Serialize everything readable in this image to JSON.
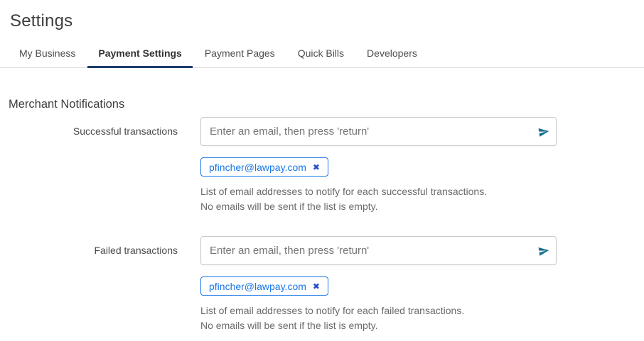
{
  "page_title": "Settings",
  "tabs": [
    {
      "label": "My Business"
    },
    {
      "label": "Payment Settings"
    },
    {
      "label": "Payment Pages"
    },
    {
      "label": "Quick Bills"
    },
    {
      "label": "Developers"
    }
  ],
  "active_tab": "Payment Settings",
  "section_title": "Merchant Notifications",
  "groups": [
    {
      "label": "Successful transactions",
      "placeholder": "Enter an email, then press 'return'",
      "chip": {
        "email": "pfincher@lawpay.com",
        "remove_glyph": "✖"
      },
      "helper": [
        "List of email addresses to notify for each successful transactions.",
        "No emails will be sent if the list is empty."
      ]
    },
    {
      "label": "Failed transactions",
      "placeholder": "Enter an email, then press 'return'",
      "chip": {
        "email": "pfincher@lawpay.com",
        "remove_glyph": "✖"
      },
      "helper": [
        "List of email addresses to notify for each failed transactions.",
        "No emails will be sent if the list is empty."
      ]
    }
  ],
  "colors": {
    "tab_underline_navy": "#1e3d6f",
    "chip_blue": "#1a77e8",
    "chip_remove_blue": "#2b4fc8",
    "send_icon_teal": "#19718f",
    "divider_gray": "#dcdcdc"
  }
}
